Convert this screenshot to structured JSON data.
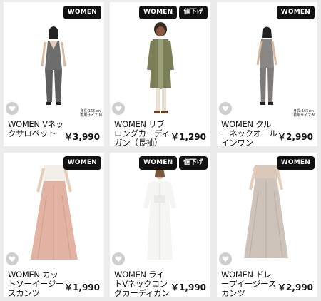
{
  "products": [
    {
      "name": "WOMEN Vネックサロペット",
      "price": "￥3,990",
      "badges": [
        "WOMEN"
      ],
      "size_note": [
        "身長:165cm",
        "着用サイズ:M"
      ]
    },
    {
      "name": "WOMEN リブロングカーディガン（長袖）",
      "price": "￥1,290",
      "badges": [
        "WOMEN",
        "値下げ"
      ],
      "size_note": []
    },
    {
      "name": "WOMEN クルーネックオールインワン",
      "price": "￥2,990",
      "badges": [
        "WOMEN"
      ],
      "size_note": [
        "身長:165cm",
        "着用サイズ:M"
      ]
    },
    {
      "name": "WOMEN カットソーイージースカンツ",
      "price": "￥1,990",
      "badges": [
        "WOMEN"
      ],
      "size_note": []
    },
    {
      "name": "WOMEN ライトVネックロングカーディガン（長袖）",
      "price": "￥1,990",
      "badges": [
        "WOMEN",
        "値下げ"
      ],
      "size_note": []
    },
    {
      "name": "WOMEN ドレープイージースカンツ",
      "price": "￥2,990",
      "badges": [
        "WOMEN"
      ],
      "size_note": []
    }
  ],
  "icons": {
    "favorite": "heart-icon"
  },
  "colors": {
    "badge_bg": "#111111",
    "fav_bg": "#cfcfcf",
    "page_bg": "#ececec"
  }
}
